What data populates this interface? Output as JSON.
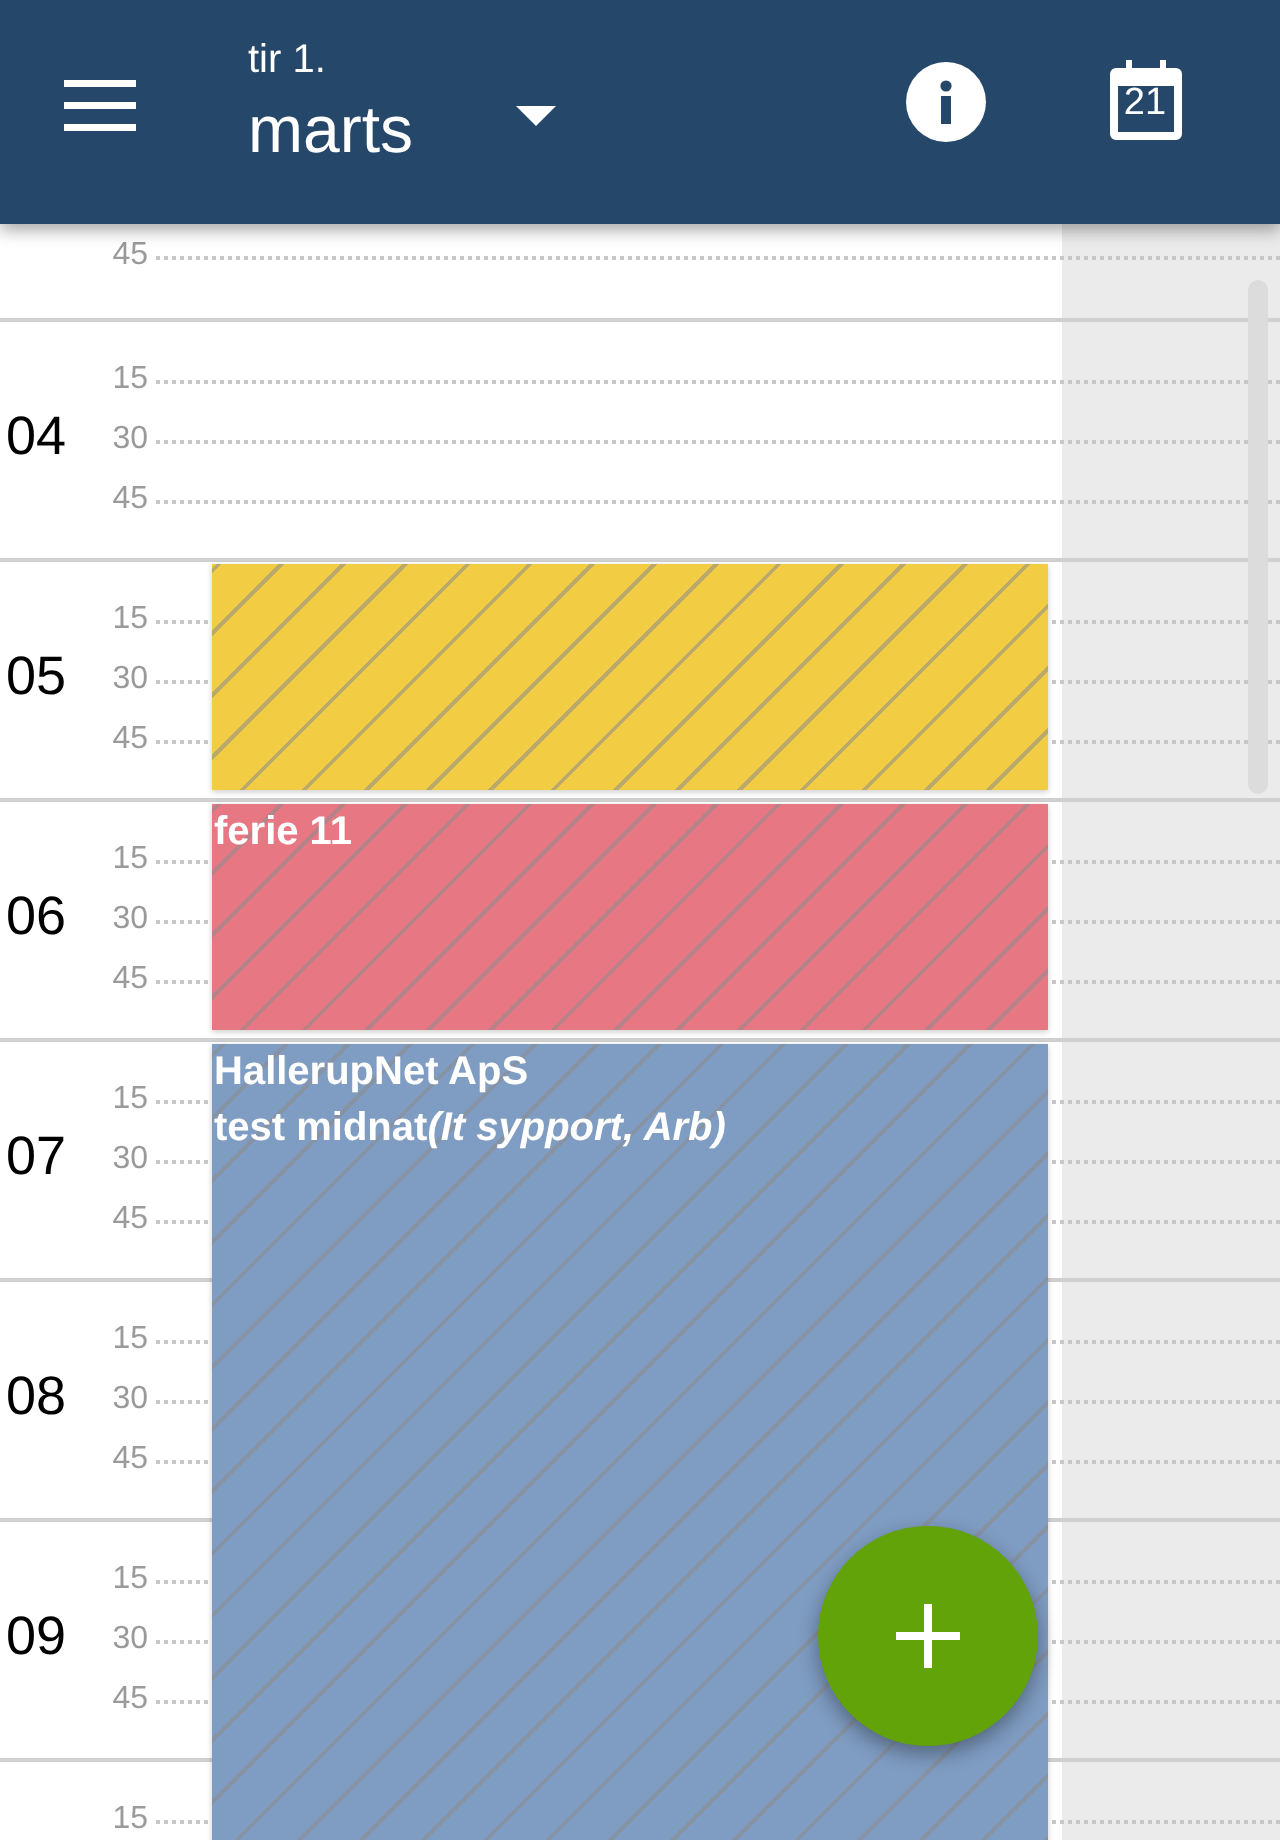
{
  "header": {
    "weekday_day": "tir 1.",
    "month": "marts",
    "calendar_day": "21"
  },
  "hours": [
    {
      "minutes": [
        "45"
      ]
    },
    {
      "hour": "04",
      "minutes": [
        "15",
        "30",
        "45"
      ]
    },
    {
      "hour": "05",
      "minutes": [
        "15",
        "30",
        "45"
      ],
      "events": [
        {
          "color": "#f2cd43"
        }
      ]
    },
    {
      "hour": "06",
      "minutes": [
        "15",
        "30",
        "45"
      ],
      "events": [
        {
          "color": "#e77783",
          "lines": [
            {
              "text": "ferie 11"
            }
          ]
        }
      ]
    },
    {
      "hour": "07",
      "minutes": [
        "15",
        "30",
        "45"
      ],
      "events": [
        {
          "color": "#7f9cc2",
          "lines": [
            {
              "text": "HallerupNet ApS"
            },
            {
              "text": "test midnat",
              "note": "(It sypport, Arb)"
            }
          ]
        }
      ]
    },
    {
      "hour": "08",
      "minutes": [
        "15",
        "30",
        "45"
      ]
    },
    {
      "hour": "09",
      "minutes": [
        "15",
        "30",
        "45"
      ]
    },
    {
      "minutes": [
        "15"
      ]
    }
  ]
}
